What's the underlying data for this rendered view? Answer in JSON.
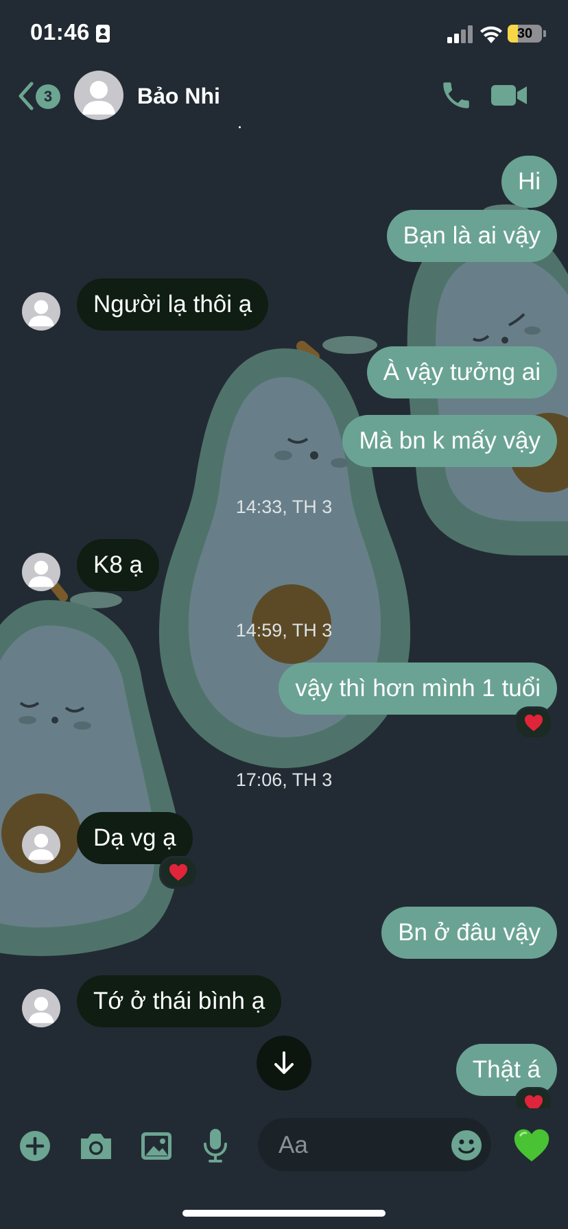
{
  "status_bar": {
    "time": "01:46",
    "battery": "30",
    "battery_level": 0.3
  },
  "header": {
    "back_count": "3",
    "contact_name": "Bảo Nhi"
  },
  "messages": [
    {
      "dir": "out",
      "text": "Hi"
    },
    {
      "dir": "out",
      "text": "Bạn là ai vậy"
    },
    {
      "dir": "in",
      "text": "Người lạ thôi ạ"
    },
    {
      "dir": "out",
      "text": "À vậy tưởng ai"
    },
    {
      "dir": "out",
      "text": "Mà bn k mấy vậy"
    },
    {
      "timestamp": "14:33, TH 3"
    },
    {
      "dir": "in",
      "text": "K8 ạ"
    },
    {
      "timestamp": "14:59, TH 3"
    },
    {
      "dir": "out",
      "text": "vậy thì hơn mình 1 tuổi",
      "reaction": "heart"
    },
    {
      "timestamp": "17:06, TH 3"
    },
    {
      "dir": "in",
      "text": "Dạ vg ạ",
      "reaction": "heart"
    },
    {
      "dir": "out",
      "text": "Bn ở đâu vậy"
    },
    {
      "dir": "in",
      "text": "Tớ ở thái bình ạ"
    },
    {
      "dir": "out",
      "text": "Thật á",
      "reaction": "heart"
    }
  ],
  "composer": {
    "placeholder": "Aa",
    "icons": [
      "plus-icon",
      "camera-icon",
      "image-icon",
      "microphone-icon",
      "emoji-icon",
      "green-heart-icon"
    ]
  },
  "colors": {
    "background": "#222b33",
    "outgoing_bubble": "#6aa393",
    "incoming_bubble": "#0f1d12",
    "accent": "#6ca592"
  }
}
